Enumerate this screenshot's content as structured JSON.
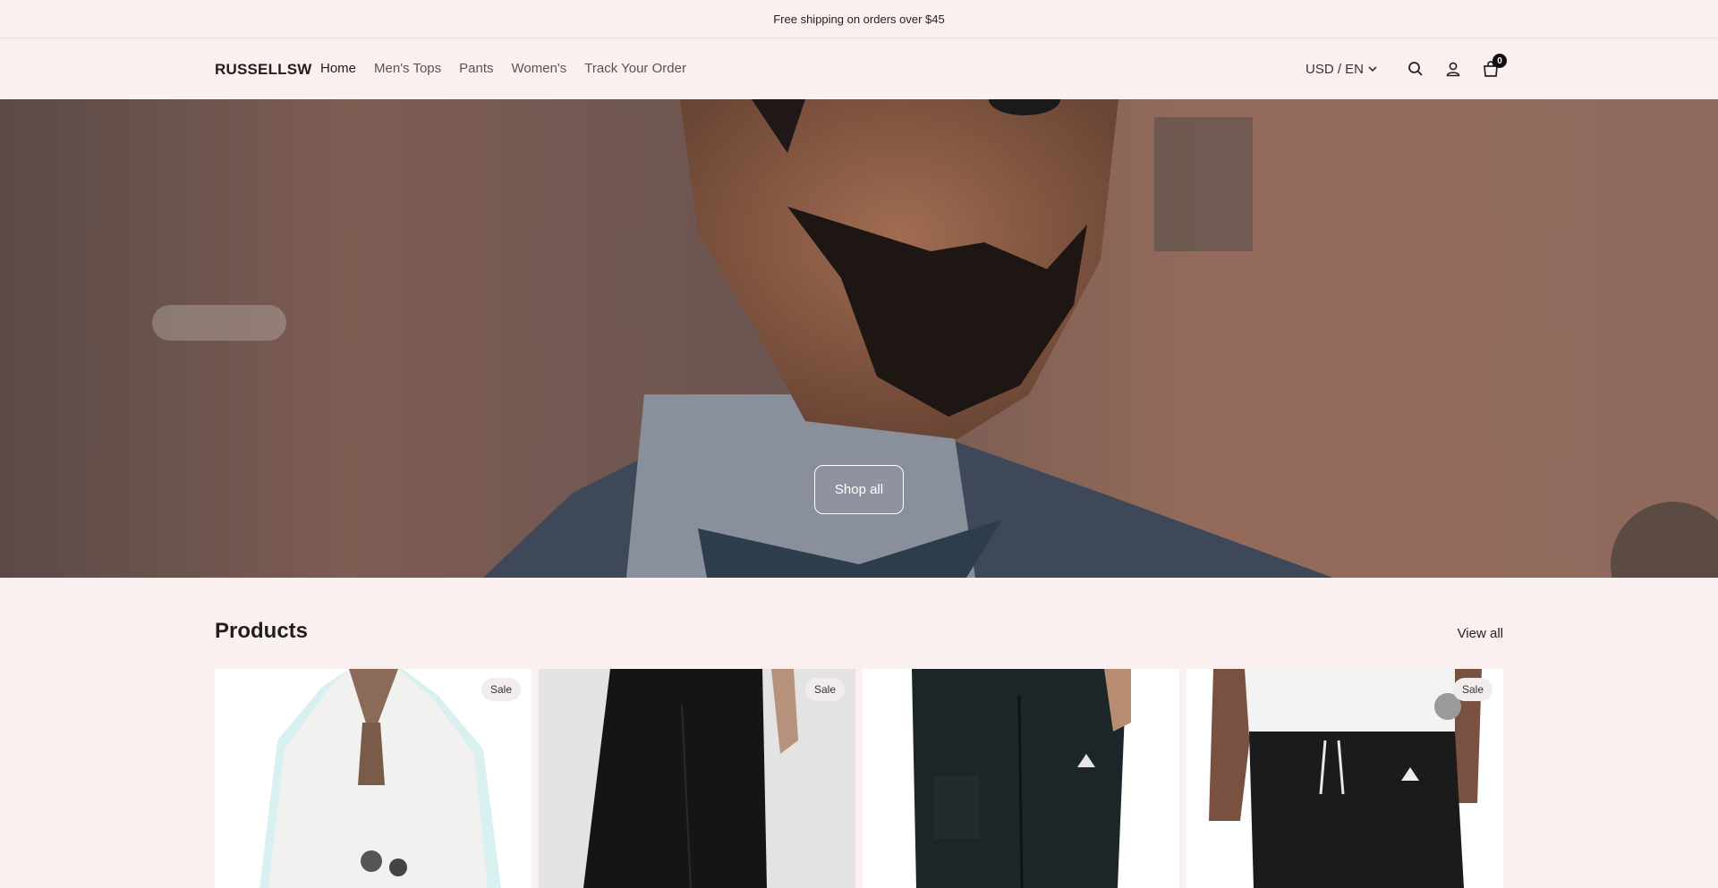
{
  "announcement": {
    "text": "Free shipping on orders over $45"
  },
  "header": {
    "logo": "RUSSELLSW",
    "nav": [
      {
        "label": "Home",
        "active": true
      },
      {
        "label": "Men's Tops"
      },
      {
        "label": "Pants"
      },
      {
        "label": "Women's"
      },
      {
        "label": "Track Your Order"
      }
    ],
    "currency": "USD / EN",
    "cart_count": "0",
    "icons": [
      "chevron-down-icon",
      "search-icon",
      "account-icon",
      "cart-icon"
    ]
  },
  "hero": {
    "button_label": "Shop all"
  },
  "products": {
    "title": "Products",
    "view_all": "View all",
    "items": [
      {
        "badge": "Sale"
      },
      {
        "badge": "Sale"
      },
      {
        "badge": ""
      },
      {
        "badge": "Sale"
      }
    ]
  },
  "colors": {
    "background": "#fbf0f0",
    "text": "#1f1f1f",
    "badge_bg": "#f2ecec"
  }
}
